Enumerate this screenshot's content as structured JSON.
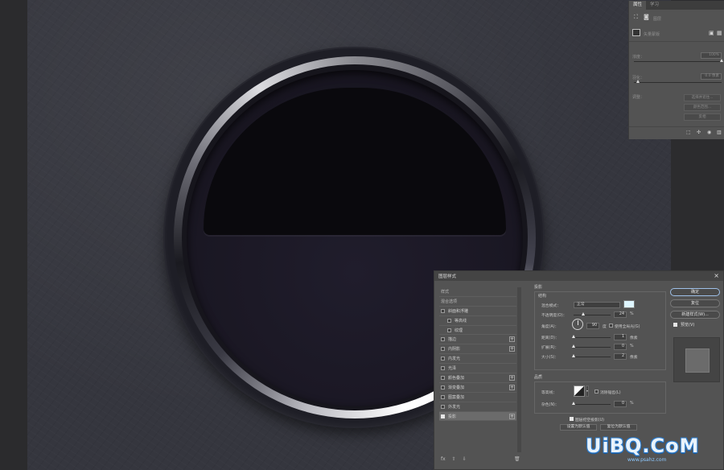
{
  "properties_panel": {
    "tabs": [
      "属性",
      "学习"
    ],
    "active_tab": "属性",
    "layer_label": "图层",
    "mask_label": "矢量蒙版",
    "density_label": "浓度：",
    "density_value": "100%",
    "feather_label": "羽化：",
    "feather_value": "0.0 像素",
    "refine_label": "调整：",
    "buttons": [
      "选择并遮住...",
      "颜色范围...",
      "反相"
    ]
  },
  "layer_style_dialog": {
    "title": "图层样式",
    "close": "×",
    "styles": [
      {
        "label": "样式",
        "type": "header"
      },
      {
        "label": "混合选项",
        "type": "header"
      },
      {
        "label": "斜面和浮雕",
        "checked": false
      },
      {
        "label": "等高线",
        "checked": false,
        "sub": true
      },
      {
        "label": "纹理",
        "checked": false,
        "sub": true
      },
      {
        "label": "描边",
        "checked": false,
        "plus": true
      },
      {
        "label": "内阴影",
        "checked": false,
        "plus": true
      },
      {
        "label": "内发光",
        "checked": false
      },
      {
        "label": "光泽",
        "checked": false
      },
      {
        "label": "颜色叠加",
        "checked": false,
        "plus": true
      },
      {
        "label": "渐变叠加",
        "checked": false,
        "plus": true
      },
      {
        "label": "图案叠加",
        "checked": false
      },
      {
        "label": "外发光",
        "checked": false
      },
      {
        "label": "投影",
        "checked": true,
        "plus": true,
        "selected": true
      }
    ],
    "shadow": {
      "section_title": "投影",
      "structure_title": "结构",
      "blend_mode_label": "混合模式：",
      "blend_mode": "正常",
      "shadow_color": "#dff6ff",
      "opacity_label": "不透明度(O)：",
      "opacity": "24",
      "angle_label": "角度(A)：",
      "angle": "90",
      "angle_unit": "度",
      "global_light_label": "使用全局光(G)",
      "distance_label": "距离(D)：",
      "distance": "1",
      "spread_label": "扩展(R)：",
      "spread": "0",
      "size_label": "大小(S)：",
      "size": "2",
      "unit_px": "像素",
      "unit_pct": "%",
      "quality_title": "品质",
      "contour_label": "等高线：",
      "antialias_label": "消除锯齿(L)",
      "noise_label": "杂色(N)：",
      "noise": "0",
      "knockout_label": "图层挖空投影(U)",
      "default_btn": "设置为默认值",
      "reset_btn": "复位为默认值"
    },
    "buttons": {
      "ok": "确定",
      "cancel": "复位",
      "new_style": "新建样式(W)...",
      "preview": "预览(V)"
    },
    "tools": {
      "fx": "fx",
      "up": "⇧",
      "down": "⇩",
      "trash": "🗑"
    }
  },
  "watermark": {
    "main": "UiBQ.CoM",
    "sub": "www.psahz.com"
  },
  "colors": {
    "canvas": "#35363e",
    "dial": "#1a1723",
    "semi": "#0a090d"
  }
}
